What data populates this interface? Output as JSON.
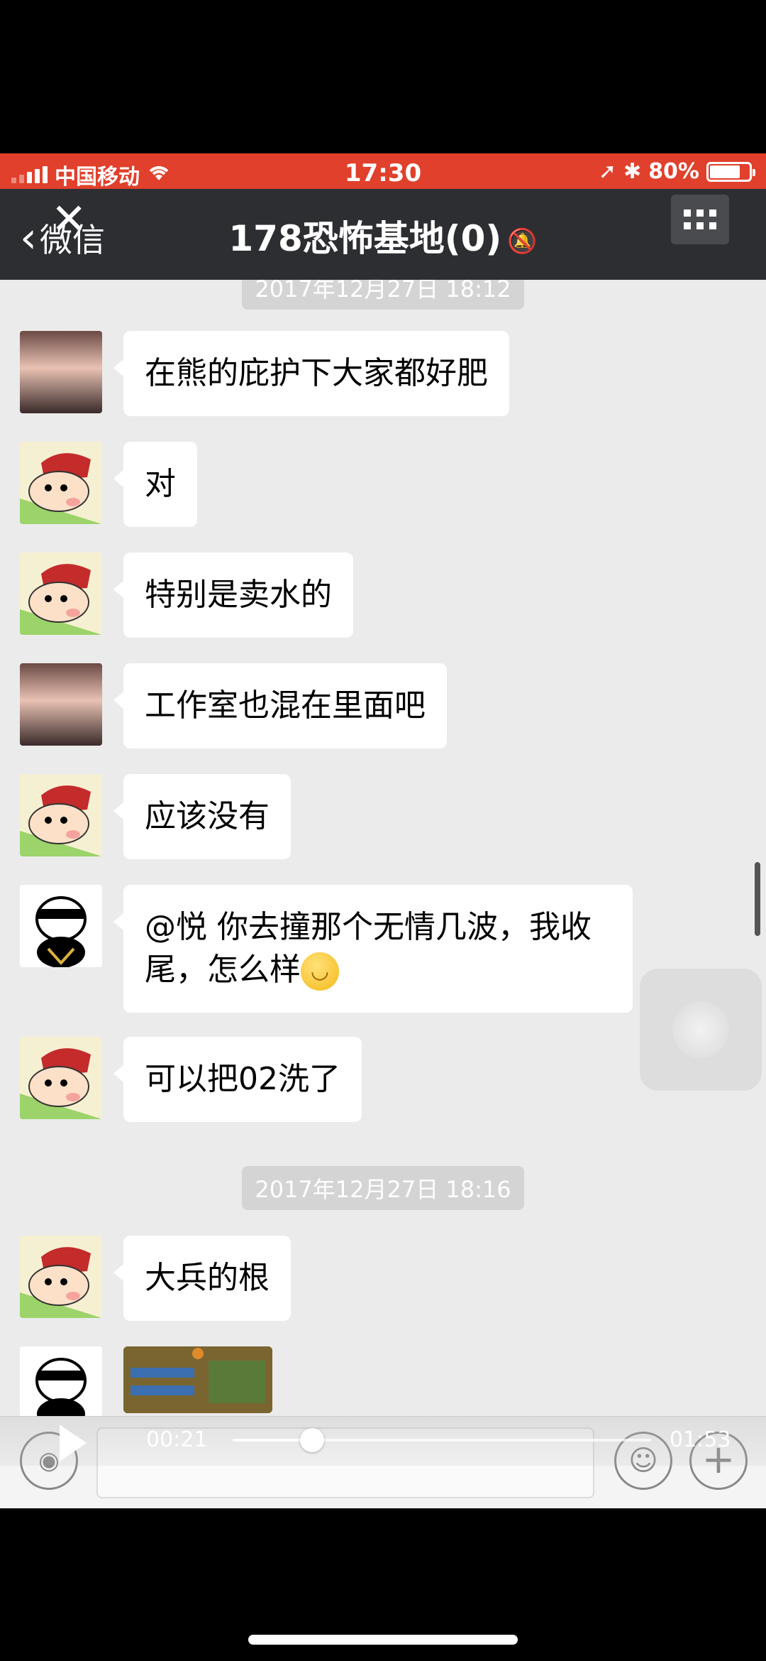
{
  "status_bar": {
    "carrier": "中国移动",
    "time": "17:30",
    "battery": "80%",
    "battery_level": 0.8
  },
  "nav": {
    "back_label": "微信",
    "title": "178恐怖基地(0)"
  },
  "timestamps": [
    "2017年12月27日 18:12",
    "2017年12月27日 18:16"
  ],
  "messages": [
    {
      "avatar": "girl-avatar",
      "text": "在熊的庇护下大家都好肥"
    },
    {
      "avatar": "shinchan-avatar",
      "text": "对"
    },
    {
      "avatar": "shinchan-avatar",
      "text": "特别是卖水的"
    },
    {
      "avatar": "girl-avatar",
      "text": "工作室也混在里面吧"
    },
    {
      "avatar": "shinchan-avatar",
      "text": "应该没有"
    },
    {
      "avatar": "panda-avatar",
      "text_line1": "@悦 你去撞那个无情几波，我收",
      "text_line2": "尾，怎么样"
    },
    {
      "avatar": "shinchan-avatar",
      "text": "可以把02洗了"
    },
    {
      "avatar": "shinchan-avatar",
      "text": "大兵的根"
    },
    {
      "avatar": "panda-avatar",
      "type": "image"
    }
  ],
  "player": {
    "current_time": "00:21",
    "total_time": "01:53",
    "progress": 0.19
  },
  "colors": {
    "status_bar": "#e0402c",
    "nav_bar": "#2d2e32",
    "chat_bg": "#ebebeb",
    "bubble": "#ffffff"
  }
}
